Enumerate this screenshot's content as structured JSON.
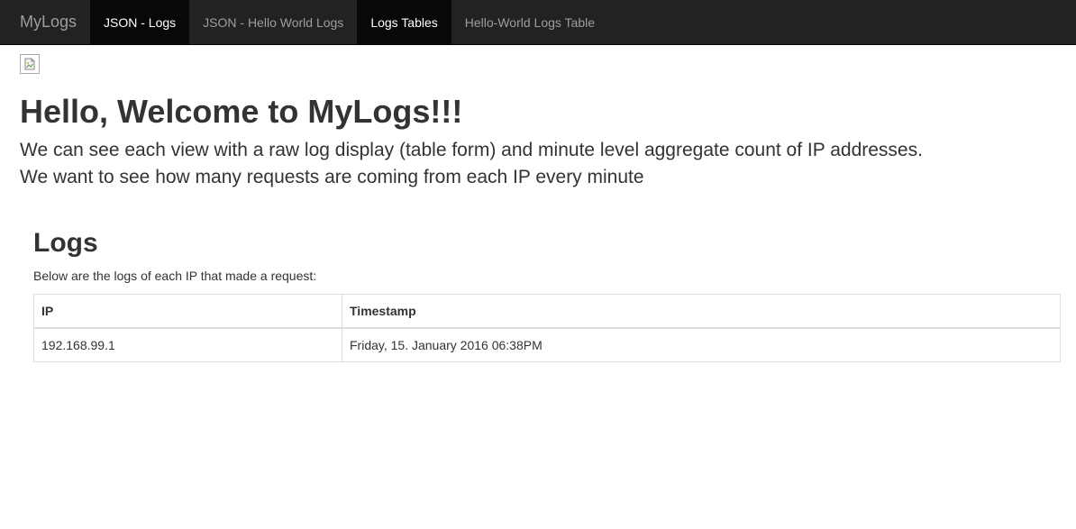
{
  "navbar": {
    "brand": "MyLogs",
    "items": [
      {
        "label": "JSON - Logs",
        "active": true
      },
      {
        "label": "JSON - Hello World Logs",
        "active": false
      },
      {
        "label": "Logs Tables",
        "active": true
      },
      {
        "label": "Hello-World Logs Table",
        "active": false
      }
    ]
  },
  "icons": {
    "broken_image": "broken-image-icon"
  },
  "jumbotron": {
    "title": "Hello, Welcome to MyLogs!!!",
    "line1": "We can see each view with a raw log display (table form) and minute level aggregate count of IP addresses.",
    "line2": "We want to see how many requests are coming from each IP every minute"
  },
  "logs": {
    "heading": "Logs",
    "description": "Below are the logs of each IP that made a request:",
    "columns": [
      "IP",
      "Timestamp"
    ],
    "rows": [
      {
        "ip": "192.168.99.1",
        "timestamp": "Friday, 15. January 2016 06:38PM"
      }
    ]
  },
  "colors": {
    "navbar_bg": "#222222",
    "nav_active_bg": "#080808",
    "nav_text": "#9d9d9d",
    "text": "#333333"
  }
}
